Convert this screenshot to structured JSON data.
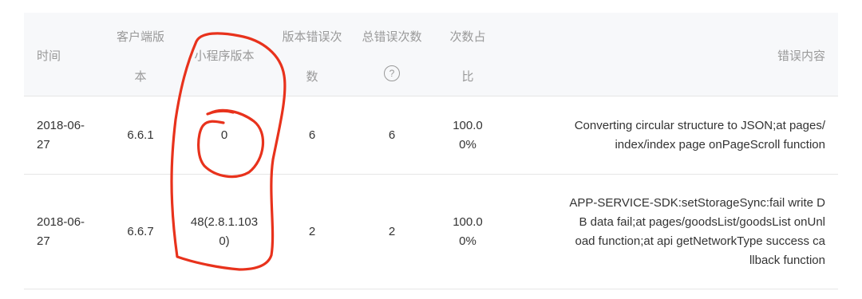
{
  "table": {
    "headers": {
      "time": "时间",
      "client_version": [
        "客户端版",
        "本"
      ],
      "mini_version": "小程序版本",
      "version_errors": [
        "版本错误次",
        "数"
      ],
      "total_errors": "总错误次数",
      "ratio": [
        "次数占",
        "比"
      ],
      "error_content": "错误内容"
    },
    "help_icon": "question-circle-icon",
    "rows": [
      {
        "date": [
          "2018-06-",
          "27"
        ],
        "client_version": "6.6.1",
        "mini_version": [
          "0"
        ],
        "version_errors": "6",
        "total_errors": "6",
        "ratio": [
          "100.0",
          "0%"
        ],
        "message": [
          "Converting circular structure to JSON;at pages/",
          "index/index page onPageScroll function"
        ]
      },
      {
        "date": [
          "2018-06-",
          "27"
        ],
        "client_version": "6.6.7",
        "mini_version": [
          "48(2.8.1.103",
          "0)"
        ],
        "version_errors": "2",
        "total_errors": "2",
        "ratio": [
          "100.0",
          "0%"
        ],
        "message": [
          "APP-SERVICE-SDK:setStorageSync:fail write D",
          "B data fail;at pages/goodsList/goodsList onUnl",
          "oad function;at api getNetworkType success ca",
          "llback function"
        ]
      }
    ]
  },
  "annotation": {
    "color": "#e8321c"
  }
}
